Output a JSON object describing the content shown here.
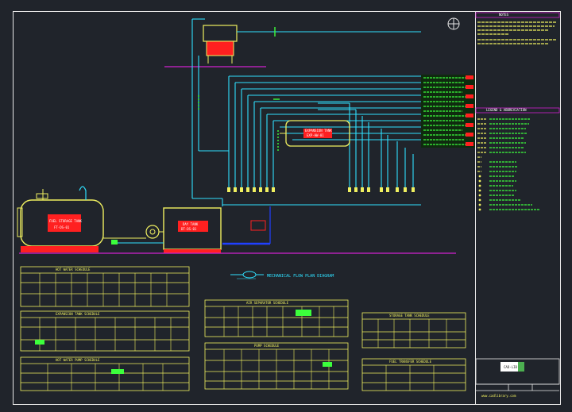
{
  "drawing": {
    "notes_title": "NOTES",
    "legend_title": "LEGEND & ABBREVIATION",
    "center_caption": "MECHANICAL FLOW PLAN DIAGRAM",
    "tank_left_label": "FUEL STORAGE TANK",
    "tank_left_code": "FT-DS-01",
    "boiler_label": "DAY TANK",
    "boiler_code": "DT-DS-01",
    "mid_tank_label": "EXPANSION TANK",
    "mid_tank_code": "EXP-HW-01",
    "company_logo_text": "CAD-LIB",
    "website": "www.cadlibrary.com"
  },
  "tables": [
    {
      "title": "HOT WATER SCHEDULE"
    },
    {
      "title": "EXPANSION TANK SCHEDULE"
    },
    {
      "title": "HOT WATER PUMP SCHEDULE"
    },
    {
      "title": "AIR SEPARATOR SCHEDULE"
    },
    {
      "title": "PUMP SCHEDULE"
    },
    {
      "title": "STORAGE TANK SCHEDULE"
    },
    {
      "title": "FUEL TRANSFER SCHEDULE"
    }
  ],
  "colors": {
    "pipe_cyan": "#2fe0ff",
    "pipe_green": "#3cff3c",
    "pipe_yellow": "#f0f060",
    "pipe_magenta": "#d020d0",
    "equipment_red": "#ff2020",
    "frame_white": "#e8e8e8"
  }
}
